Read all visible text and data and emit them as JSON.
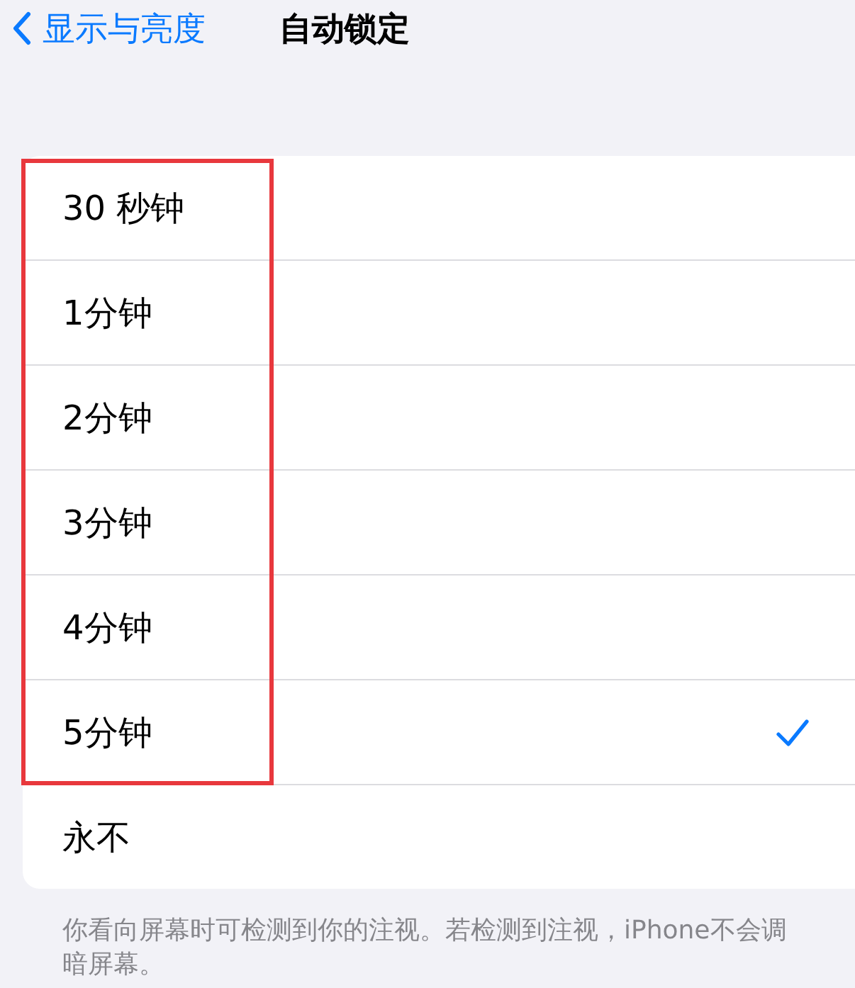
{
  "nav": {
    "back_label": "显示与亮度",
    "title": "自动锁定"
  },
  "options": [
    {
      "label": "30 秒钟",
      "selected": false
    },
    {
      "label": "1分钟",
      "selected": false
    },
    {
      "label": "2分钟",
      "selected": false
    },
    {
      "label": "3分钟",
      "selected": false
    },
    {
      "label": "4分钟",
      "selected": false
    },
    {
      "label": "5分钟",
      "selected": true
    },
    {
      "label": "永不",
      "selected": false
    }
  ],
  "footer": "你看向屏幕时可检测到你的注视。若检测到注视，iPhone不会调暗屏幕。"
}
